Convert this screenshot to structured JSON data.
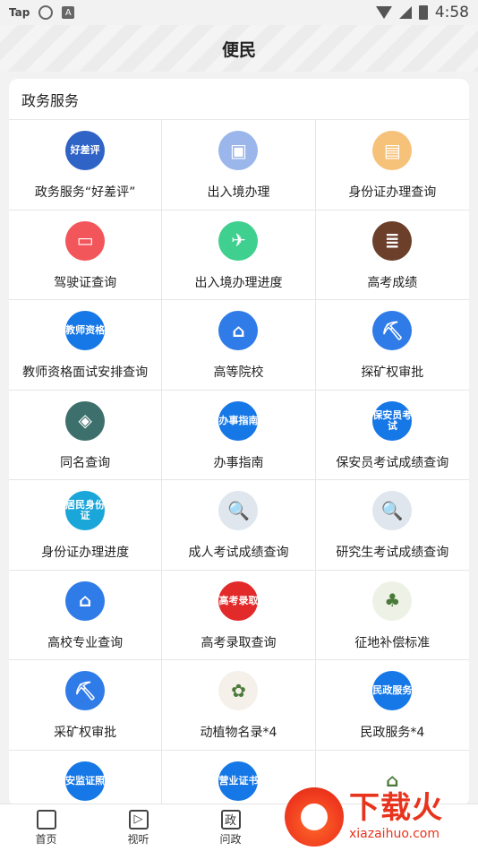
{
  "status_bar": {
    "app": "Tap",
    "time": "4:58"
  },
  "header": {
    "title": "便民"
  },
  "section": {
    "title": "政务服务"
  },
  "items": [
    {
      "label": "政务服务“好差评”",
      "icon": "好差评",
      "color": "#2f63c6"
    },
    {
      "label": "出入境办理",
      "icon": "passport-icon",
      "color": "#9bb6ea"
    },
    {
      "label": "身份证办理查询",
      "icon": "id-card-icon",
      "color": "#f6c27a"
    },
    {
      "label": "驾驶证查询",
      "icon": "driver-license-icon",
      "color": "#f2555a"
    },
    {
      "label": "出入境办理进度",
      "icon": "plane-icon",
      "color": "#3fcf8e"
    },
    {
      "label": "高考成绩",
      "icon": "exam-score-icon",
      "color": "#6b3f2a"
    },
    {
      "label": "教师资格面试安排查询",
      "icon": "教师资格",
      "color": "#1677e6"
    },
    {
      "label": "高等院校",
      "icon": "school-icon",
      "color": "#2f7be8"
    },
    {
      "label": "探矿权审批",
      "icon": "mining-icon",
      "color": "#2f7be8"
    },
    {
      "label": "同名查询",
      "icon": "same-name-icon",
      "color": "#3d6f6c"
    },
    {
      "label": "办事指南",
      "icon": "办事指南",
      "color": "#1677e6"
    },
    {
      "label": "保安员考试成绩查询",
      "icon": "保安员考试",
      "color": "#1677e6"
    },
    {
      "label": "身份证办理进度",
      "icon": "居民身份证",
      "color": "#1aa6d9"
    },
    {
      "label": "成人考试成绩查询",
      "icon": "ad-search-icon",
      "color": "#dfe6ee"
    },
    {
      "label": "研究生考试成绩查询",
      "icon": "ad-search-icon",
      "color": "#dfe6ee"
    },
    {
      "label": "高校专业查询",
      "icon": "university-icon",
      "color": "#2f7be8"
    },
    {
      "label": "高考录取查询",
      "icon": "高考录取",
      "color": "#e32a2a"
    },
    {
      "label": "征地补偿标准",
      "icon": "land-icon",
      "color": "#eef2e6"
    },
    {
      "label": "采矿权审批",
      "icon": "mining-icon",
      "color": "#2f7be8"
    },
    {
      "label": "动植物名录*4",
      "icon": "animals-icon",
      "color": "#f5f0ea"
    },
    {
      "label": "民政服务*4",
      "icon": "民政服务",
      "color": "#1677e6"
    },
    {
      "label": "",
      "icon": "安监证照",
      "color": "#1677e6"
    },
    {
      "label": "",
      "icon": "营业证书",
      "color": "#1677e6"
    },
    {
      "label": "",
      "icon": "house-icon",
      "color": "#ffffff"
    }
  ],
  "tabs": [
    {
      "label": "首页",
      "icon": "home-icon"
    },
    {
      "label": "视听",
      "icon": "tv-icon"
    },
    {
      "label": "问政",
      "icon": "政"
    }
  ],
  "watermark": {
    "text": "下载火",
    "url": "xiazaihuo.com"
  }
}
